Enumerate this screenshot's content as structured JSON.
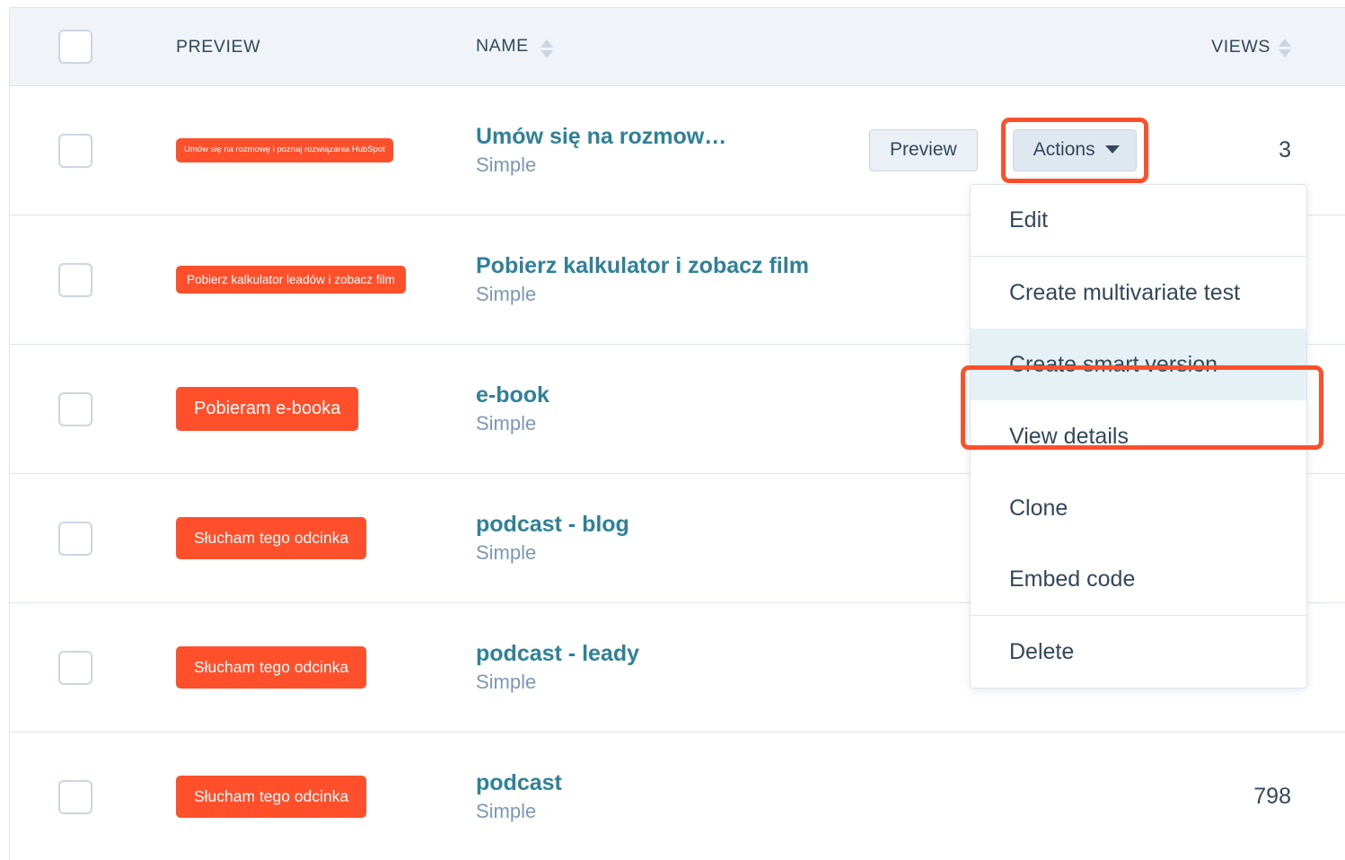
{
  "table": {
    "columns": {
      "preview": "PREVIEW",
      "name": "NAME",
      "views": "VIEWS"
    },
    "rows": [
      {
        "cta_label": "Umów się na rozmowę i poznaj rozwiązania HubSpot",
        "cta_size": "size-xs",
        "name": "Umów się na rozmow…",
        "type": "Simple",
        "views": "3",
        "preview_button": "Preview",
        "actions_button": "Actions"
      },
      {
        "cta_label": "Pobierz kalkulator leadów i zobacz film",
        "cta_size": "size-sm",
        "name": "Pobierz kalkulator i zobacz film",
        "type": "Simple",
        "views": ""
      },
      {
        "cta_label": "Pobieram e-booka",
        "cta_size": "size-md",
        "name": "e-book",
        "type": "Simple",
        "views": ""
      },
      {
        "cta_label": "Słucham tego odcinka",
        "cta_size": "size-lg",
        "name": "podcast - blog",
        "type": "Simple",
        "views": ""
      },
      {
        "cta_label": "Słucham tego odcinka",
        "cta_size": "size-lg",
        "name": "podcast - leady",
        "type": "Simple",
        "views": ""
      },
      {
        "cta_label": "Słucham tego odcinka",
        "cta_size": "size-lg",
        "name": "podcast",
        "type": "Simple",
        "views": "798"
      }
    ]
  },
  "actions_menu": {
    "items": [
      {
        "label": "Edit",
        "selected": false,
        "separator_below": true
      },
      {
        "label": "Create multivariate test",
        "selected": false,
        "separator_below": false
      },
      {
        "label": "Create smart version",
        "selected": true,
        "separator_below": false
      },
      {
        "label": "View details",
        "selected": false,
        "separator_below": false
      },
      {
        "label": "Clone",
        "selected": false,
        "separator_below": false
      },
      {
        "label": "Embed code",
        "selected": false,
        "separator_below": true
      },
      {
        "label": "Delete",
        "selected": false,
        "separator_below": false
      }
    ]
  },
  "colors": {
    "cta_orange": "#ff4f2b",
    "link_teal": "#2d8198",
    "text_dark": "#33475b",
    "muted": "#7c98b6",
    "header_bg": "#f0f3f7",
    "selected_bg": "#e5f1f5",
    "border": "#dfe3eb"
  }
}
